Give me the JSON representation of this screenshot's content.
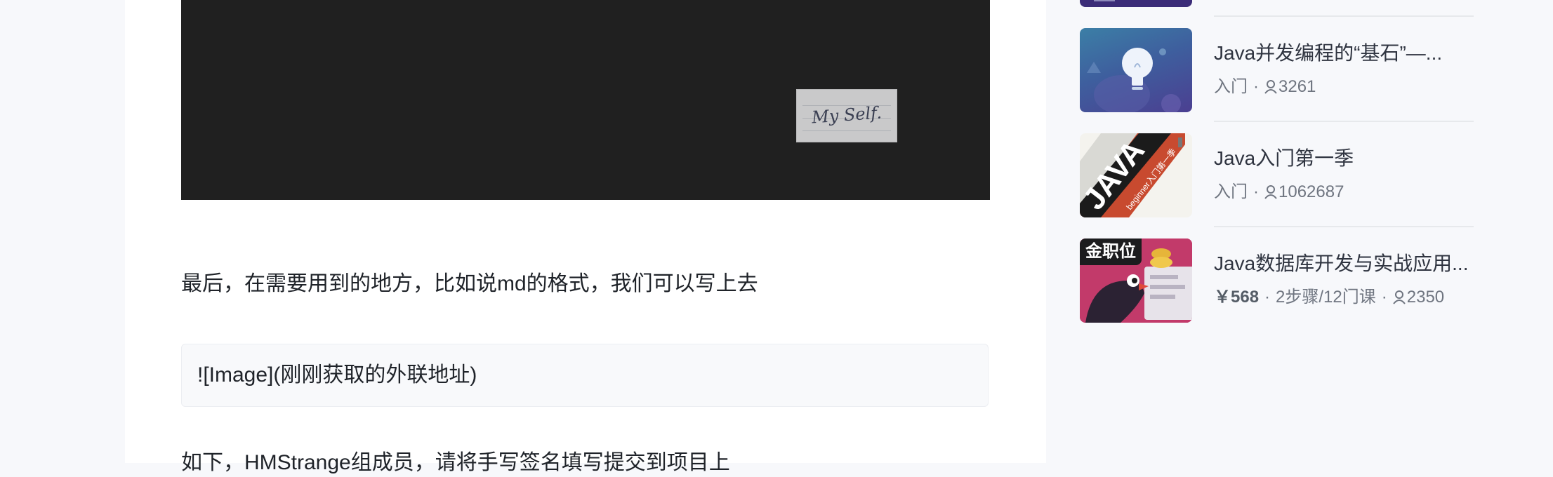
{
  "article": {
    "signature_text": "My Self.",
    "paragraph_1": "最后，在需要用到的地方，比如说md的格式，我们可以写上去",
    "code_line": "![Image](刚刚获取的外联地址)",
    "paragraph_2": "如下，HMStrange组成员，请将手写签名填写提交到项目上"
  },
  "sidebar": {
    "courses": [
      {
        "title": "Java并发编程的“基石”—...",
        "level": "入门",
        "students": "3261",
        "icon": "lightbulb-icon"
      },
      {
        "title": "Java入门第一季",
        "level": "入门",
        "students": "1062687",
        "thumb_text": "JAVA",
        "thumb_sub": "beginner入门第一季"
      },
      {
        "title": "Java数据库开发与实战应用...",
        "badge": "金职位",
        "price": "￥568",
        "steps": "2步骤/12门课",
        "students": "2350"
      }
    ]
  },
  "colors": {
    "accent_dark": "#202020",
    "badge_bg": "#1c1c1e",
    "thumb_blue": "#3c6aa8",
    "java_red": "#c84a2f",
    "db_pink": "#c23a6a"
  }
}
